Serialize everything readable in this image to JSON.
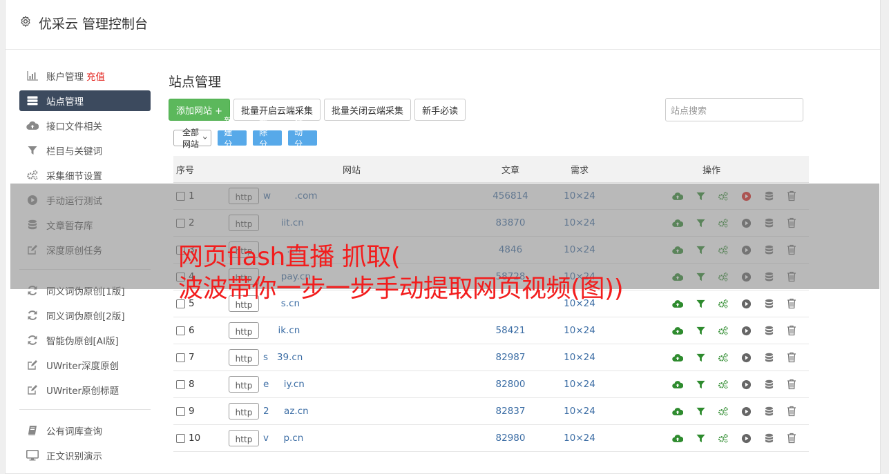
{
  "app": {
    "title": "优采云 管理控制台"
  },
  "sidebar": {
    "group1": [
      {
        "label": "账户管理",
        "extra": "充值",
        "icon": "bar-chart-icon"
      },
      {
        "label": "站点管理",
        "icon": "server-icon",
        "active": true
      },
      {
        "label": "接口文件相关",
        "icon": "cloud-upload-icon"
      },
      {
        "label": "栏目与关键词",
        "icon": "filter-icon"
      },
      {
        "label": "采集细节设置",
        "icon": "gears-icon"
      },
      {
        "label": "手动运行测试",
        "icon": "play-circle-icon"
      },
      {
        "label": "文章暂存库",
        "icon": "database-icon"
      },
      {
        "label": "深度原创任务",
        "icon": "edit-icon"
      }
    ],
    "group2": [
      {
        "label": "同义词伪原创[1版]",
        "icon": "refresh-icon"
      },
      {
        "label": "同义词伪原创[2版]",
        "icon": "refresh-icon"
      },
      {
        "label": "智能伪原创[AI版]",
        "icon": "refresh-icon"
      },
      {
        "label": "UWriter深度原创",
        "icon": "edit-icon"
      },
      {
        "label": "UWriter原创标题",
        "icon": "edit-icon"
      }
    ],
    "group3": [
      {
        "label": "公有词库查询",
        "icon": "book-icon"
      },
      {
        "label": "正文识别演示",
        "icon": "monitor-icon"
      }
    ]
  },
  "main": {
    "title": "站点管理",
    "toolbar": {
      "add": "添加网站 +",
      "batch_on": "批量开启云端采集",
      "batch_off": "批量关闭云端采集",
      "guide": "新手必读"
    },
    "search_placeholder": "站点搜索",
    "group_select": "全部网站",
    "group_buttons": {
      "new": "新建分组",
      "delete": "删除分组",
      "move": "移动分组"
    },
    "table": {
      "headers": {
        "no": "序号",
        "site": "网站",
        "articles": "文章",
        "need": "需求",
        "ops": "操作"
      },
      "rows": [
        {
          "no": "1",
          "proto": "http",
          "domain": "w        .com",
          "articles": "456814",
          "need": "10×24",
          "running": true
        },
        {
          "no": "2",
          "proto": "http",
          "domain": "      iit.cn",
          "articles": "83870",
          "need": "10×24"
        },
        {
          "no": "3",
          "proto": "http",
          "domain": "        .cn",
          "articles": "4846",
          "need": "10×24"
        },
        {
          "no": "4",
          "proto": "http",
          "domain": "      pay.cn",
          "articles": "58728",
          "need": "10×24"
        },
        {
          "no": "5",
          "proto": "http",
          "domain": "      s.cn",
          "articles": "",
          "need": "10×24"
        },
        {
          "no": "6",
          "proto": "http",
          "domain": "     ik.cn",
          "articles": "58421",
          "need": "10×24"
        },
        {
          "no": "7",
          "proto": "http",
          "domain": "s   39.cn",
          "articles": "82987",
          "need": "10×24"
        },
        {
          "no": "8",
          "proto": "http",
          "domain": "e     iy.cn",
          "articles": "82800",
          "need": "10×24"
        },
        {
          "no": "9",
          "proto": "http",
          "domain": "2     az.cn",
          "articles": "82837",
          "need": "10×24"
        },
        {
          "no": "10",
          "proto": "http",
          "domain": "v     p.cn",
          "articles": "82980",
          "need": "10×24"
        }
      ]
    }
  },
  "overlay": {
    "line1": "网页flash直播 抓取(",
    "line2": "波波带你一步一步手动提取网页视频(图))"
  },
  "colors": {
    "green": "#5cb85c",
    "blue_btn": "#57a9e9",
    "red_play": "#e3211b",
    "banner": "#f21d1d",
    "active_bg": "#3c4a5e"
  }
}
